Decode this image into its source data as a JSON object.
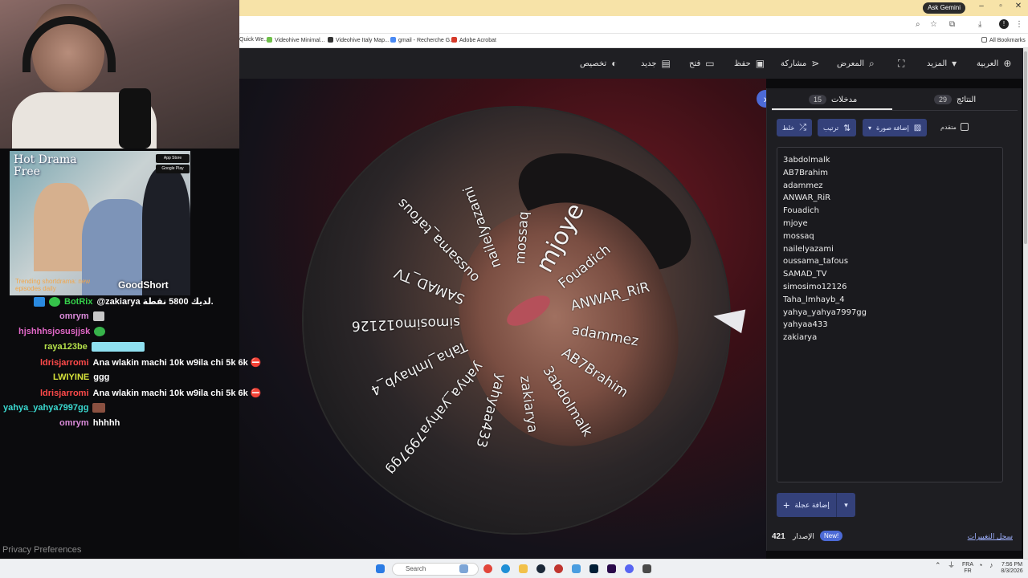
{
  "browser": {
    "ask_label": "Ask Gemini",
    "bookmarks": [
      "Quick We...",
      "Videohive Minimal...",
      "Videohive Italy Map...",
      "gmail - Recherche G...",
      "Adobe Acrobat"
    ],
    "all_bookmarks": "All Bookmarks"
  },
  "toolbar": {
    "customize": "تخصيص",
    "new": "جديد",
    "open": "فتح",
    "save": "حفظ",
    "share": "مشاركة",
    "gallery": "المعرض",
    "more": "المزيد",
    "language": "العربية"
  },
  "wheel": {
    "labels": [
      "mjoye",
      "Fouadich",
      "ANWAR_RiR",
      "adammez",
      "AB7Brahim",
      "3abdolmalk",
      "zakiarya",
      "yahyaa433",
      "yahya_yahya7997gg",
      "Taha_lmhayb_4",
      "simosimo12126",
      "SAMAD_TV",
      "oussama_tafous",
      "nailelyazami",
      "mossaq"
    ]
  },
  "panel": {
    "tab_entries_label": "مدخلات",
    "tab_entries_count": "15",
    "tab_results_label": "النتائج",
    "tab_results_count": "29",
    "shuffle": "خلط",
    "sort": "ترتيب",
    "add_image": "إضافة صورة",
    "advanced": "متقدم",
    "entries": [
      "3abdolmalk",
      "AB7Brahim",
      "adammez",
      "ANWAR_RiR",
      "Fouadich",
      "mjoye",
      "mossaq",
      "nailelyazami",
      "oussama_tafous",
      "SAMAD_TV",
      "simosimo12126",
      "Taha_lmhayb_4",
      "yahya_yahya7997gg",
      "yahyaa433",
      "zakiarya"
    ],
    "add_wheel": "إضافة عجلة",
    "version_label": "الإصدار",
    "version_number": "421",
    "new_badge": "New!",
    "changelog": "سجل التغييرات"
  },
  "ad": {
    "title": "Hot Drama Free",
    "brand": "GoodShort",
    "trending": "Trending shortdrama: new episodes daily",
    "store1": "App Store",
    "store2": "Google Play"
  },
  "chat": [
    {
      "user": "BotRix",
      "text": "@zakiarya لديك 5800 نقطة.",
      "color": "#35d14a"
    },
    {
      "user": "omrym",
      "text": "",
      "color": "#d98ad8"
    },
    {
      "user": "hjshhhsjosusjjsk",
      "text": "",
      "color": "#e368c8"
    },
    {
      "user": "raya123be",
      "text": "",
      "color": "#b6e24a"
    },
    {
      "user": "ldrisjarromi",
      "text": "Ana wlakin machi 10k w9ila chi 5k 6k ⛔",
      "color": "#ff4a4a"
    },
    {
      "user": "LWIYINE",
      "text": "ggg",
      "color": "#d6e23a"
    },
    {
      "user": "ldrisjarromi",
      "text": "Ana wlakin machi 10k w9ila chi 5k 6k ⛔",
      "color": "#ff4a4a"
    },
    {
      "user": "yahya_yahya7997gg",
      "text": "",
      "color": "#3ad9d0"
    },
    {
      "user": "omrym",
      "text": "hhhhh",
      "color": "#d98ad8"
    }
  ],
  "privacy": "Privacy Preferences",
  "taskbar": {
    "search": "Search",
    "lang": "FRA",
    "lang2": "FR",
    "time": "7:56 PM",
    "date": "8/3/2026"
  }
}
